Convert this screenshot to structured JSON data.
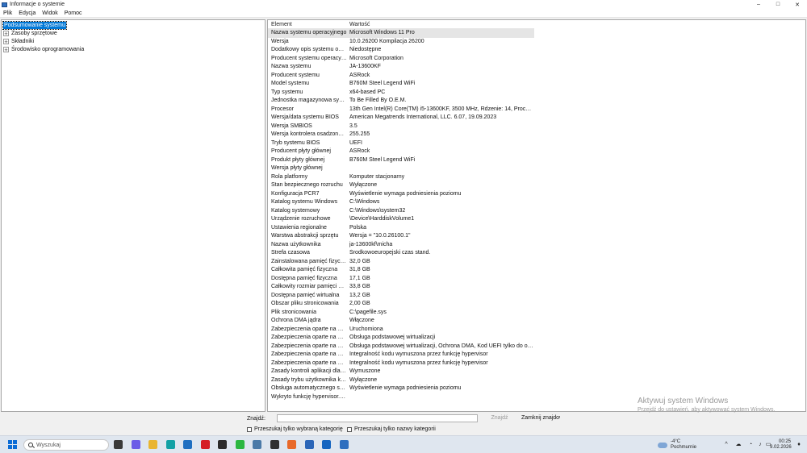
{
  "window": {
    "title": "Informacje o systemie",
    "minimize": "–",
    "maximize": "□",
    "close": "✕"
  },
  "menu": [
    "Plik",
    "Edycja",
    "Widok",
    "Pomoc"
  ],
  "tree": [
    {
      "label": "Podsumowanie systemu",
      "expander": "",
      "selected": true
    },
    {
      "label": "Zasoby sprzętowe",
      "expander": "+",
      "selected": false
    },
    {
      "label": "Składniki",
      "expander": "+",
      "selected": false
    },
    {
      "label": "Środowisko oprogramowania",
      "expander": "+",
      "selected": false
    }
  ],
  "list": {
    "headers": {
      "element": "Element",
      "value": "Wartość"
    },
    "rows": [
      {
        "element": "Nazwa systemu operacyjnego",
        "value": "Microsoft Windows 11 Pro"
      },
      {
        "element": "Wersja",
        "value": "10.0.26200 Kompilacja 26200"
      },
      {
        "element": "Dodatkowy opis systemu oper...",
        "value": "Niedostępne"
      },
      {
        "element": "Producent systemu operacyjn...",
        "value": "Microsoft Corporation"
      },
      {
        "element": "Nazwa systemu",
        "value": "JA-13600KF"
      },
      {
        "element": "Producent systemu",
        "value": "ASRock"
      },
      {
        "element": "Model systemu",
        "value": "B760M Steel Legend WiFi"
      },
      {
        "element": "Typ systemu",
        "value": "x64-based PC"
      },
      {
        "element": "Jednostka magazynowa syste...",
        "value": "To Be Filled By O.E.M."
      },
      {
        "element": "Procesor",
        "value": "13th Gen Intel(R) Core(TM) i5-13600KF, 3500 MHz, Rdzenie: 14, Procesory l..."
      },
      {
        "element": "Wersja/data systemu BIOS",
        "value": "American Megatrends International, LLC. 6.07, 19.09.2023"
      },
      {
        "element": "Wersja SMBIOS",
        "value": "3.5"
      },
      {
        "element": "Wersja kontrolera osadzonego",
        "value": "255.255"
      },
      {
        "element": "Tryb systemu BIOS",
        "value": "UEFI"
      },
      {
        "element": "Producent płyty głównej",
        "value": "ASRock"
      },
      {
        "element": "Produkt płyty głównej",
        "value": "B760M Steel Legend WiFi"
      },
      {
        "element": "Wersja płyty głównej",
        "value": ""
      },
      {
        "element": "Rola platformy",
        "value": "Komputer stacjonarny"
      },
      {
        "element": "Stan bezpiecznego rozruchu",
        "value": "Wyłączone"
      },
      {
        "element": "Konfiguracja PCR7",
        "value": "Wyświetlenie wymaga podniesienia poziomu"
      },
      {
        "element": "Katalog systemu Windows",
        "value": "C:\\Windows"
      },
      {
        "element": "Katalog systemowy",
        "value": "C:\\Windows\\system32"
      },
      {
        "element": "Urządzenie rozruchowe",
        "value": "\\Device\\HarddiskVolume1"
      },
      {
        "element": "Ustawienia regionalne",
        "value": "Polska"
      },
      {
        "element": "Warstwa abstrakcji sprzętu",
        "value": "Wersja = \"10.0.26100.1\""
      },
      {
        "element": "Nazwa użytkownika",
        "value": "ja-13600kf\\micha"
      },
      {
        "element": "Strefa czasowa",
        "value": "Środkowoeuropejski czas stand."
      },
      {
        "element": "Zainstalowana pamięć fizyczna...",
        "value": "32,0 GB"
      },
      {
        "element": "Całkowita pamięć fizyczna",
        "value": "31,8 GB"
      },
      {
        "element": "Dostępna pamięć fizyczna",
        "value": "17,1 GB"
      },
      {
        "element": "Całkowity rozmiar pamięci wir...",
        "value": "33,8 GB"
      },
      {
        "element": "Dostępna pamięć wirtualna",
        "value": "13,2 GB"
      },
      {
        "element": "Obszar pliku stronicowania",
        "value": "2,00 GB"
      },
      {
        "element": "Plik stronicowania",
        "value": "C:\\pagefile.sys"
      },
      {
        "element": "Ochrona DMA jądra",
        "value": "Włączone"
      },
      {
        "element": "Zabezpieczenia oparte na wirt...",
        "value": "Uruchomiona"
      },
      {
        "element": "Zabezpieczenia oparte na wirt...",
        "value": "Obsługa podstawowej wirtualizacji"
      },
      {
        "element": "Zabezpieczenia oparte na wirt...",
        "value": "Obsługa podstawowej wirtualizacji, Ochrona DMA, Kod UEFI tylko do odcz..."
      },
      {
        "element": "Zabezpieczenia oparte na wirt...",
        "value": "Integralność kodu wymuszona przez funkcję hypervisor"
      },
      {
        "element": "Zabezpieczenia oparte na wirt...",
        "value": "Integralność kodu wymuszona przez funkcję hypervisor"
      },
      {
        "element": "Zasady kontroli aplikacji dla fi...",
        "value": "Wymuszone"
      },
      {
        "element": "Zasady trybu użytkownika kon...",
        "value": "Wyłączone"
      },
      {
        "element": "Obsługa automatycznego szyf...",
        "value": "Wyświetlenie wymaga podniesienia poziomu"
      },
      {
        "element": "Wykryto funkcję hypervisor. F...",
        "value": ""
      }
    ]
  },
  "watermark": {
    "title": "Aktywuj system Windows",
    "subtitle": "Przejdź do ustawień, aby aktywować system Windows."
  },
  "find": {
    "label": "Znajdź:",
    "value": "",
    "find_button": "Znajdź",
    "close_button": "Zamknij znajdowanie",
    "checkbox1": "Przeszukaj tylko wybraną kategorię",
    "checkbox2": "Przeszukaj tylko nazwy kategorii"
  },
  "taskbar": {
    "search_placeholder": "Wyszukaj",
    "weather_temp": "-4°C",
    "weather_desc": "Pochmurnie",
    "time": "00:25",
    "date": "9.02.2026",
    "tray_icons": [
      "chevron-up-icon",
      "cloud-sync-icon",
      "network-icon",
      "speaker-icon",
      "battery-icon",
      "bell-icon"
    ],
    "app_icons": [
      {
        "name": "widgets-icon",
        "color": "#3a3a3a"
      },
      {
        "name": "copilot-icon",
        "color": "#6b5ce7"
      },
      {
        "name": "file-explorer-icon",
        "color": "#e9b530"
      },
      {
        "name": "edge-icon",
        "color": "#11a0a5"
      },
      {
        "name": "store-icon",
        "color": "#1f6fc1"
      },
      {
        "name": "opera-icon",
        "color": "#d51f26"
      },
      {
        "name": "terminal-icon",
        "color": "#2b2b2b"
      },
      {
        "name": "whatsapp-icon",
        "color": "#2bb741"
      },
      {
        "name": "network-tool-icon",
        "color": "#4b7aa8"
      },
      {
        "name": "obs-icon",
        "color": "#303030"
      },
      {
        "name": "browser-icon",
        "color": "#e8692a"
      },
      {
        "name": "task-view-icon",
        "color": "#2a65b8"
      },
      {
        "name": "outlook-icon",
        "color": "#1565c0"
      },
      {
        "name": "sysinfo-icon",
        "color": "#2f6fbf"
      }
    ]
  }
}
